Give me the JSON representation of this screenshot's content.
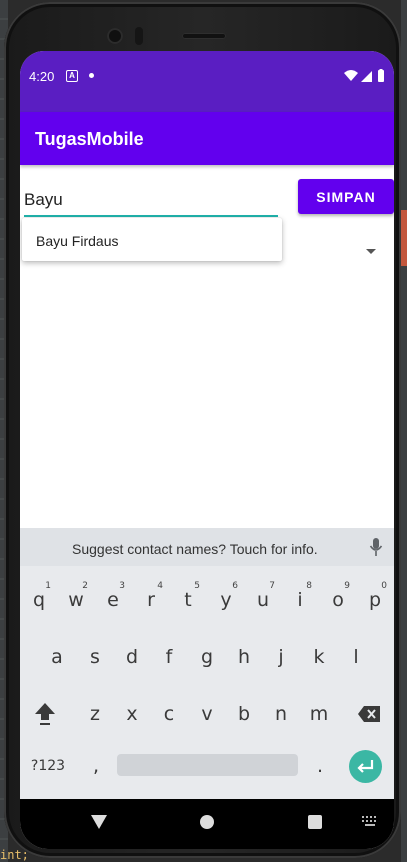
{
  "status_bar": {
    "time": "4:20",
    "notification_badge": "A"
  },
  "app_bar": {
    "title": "TugasMobile"
  },
  "form": {
    "name_input_value": "Bayu",
    "save_button_label": "SIMPAN"
  },
  "autocomplete": {
    "items": [
      "Bayu Firdaus"
    ]
  },
  "keyboard": {
    "suggestion_text": "Suggest contact names? Touch for info.",
    "row1": [
      "q",
      "w",
      "e",
      "r",
      "t",
      "y",
      "u",
      "i",
      "o",
      "p"
    ],
    "row1_hints": [
      "1",
      "2",
      "3",
      "4",
      "5",
      "6",
      "7",
      "8",
      "9",
      "0"
    ],
    "row2": [
      "a",
      "s",
      "d",
      "f",
      "g",
      "h",
      "j",
      "k",
      "l"
    ],
    "row3": [
      "z",
      "x",
      "c",
      "v",
      "b",
      "n",
      "m"
    ],
    "symbols_key": "?123",
    "comma_key": ",",
    "period_key": "."
  },
  "ide_background_text": "int;",
  "colors": {
    "status_bar": "#5a1ec2",
    "primary": "#6200ee",
    "input_underline": "#20b2aa",
    "enter_key": "#3bb7a4"
  }
}
